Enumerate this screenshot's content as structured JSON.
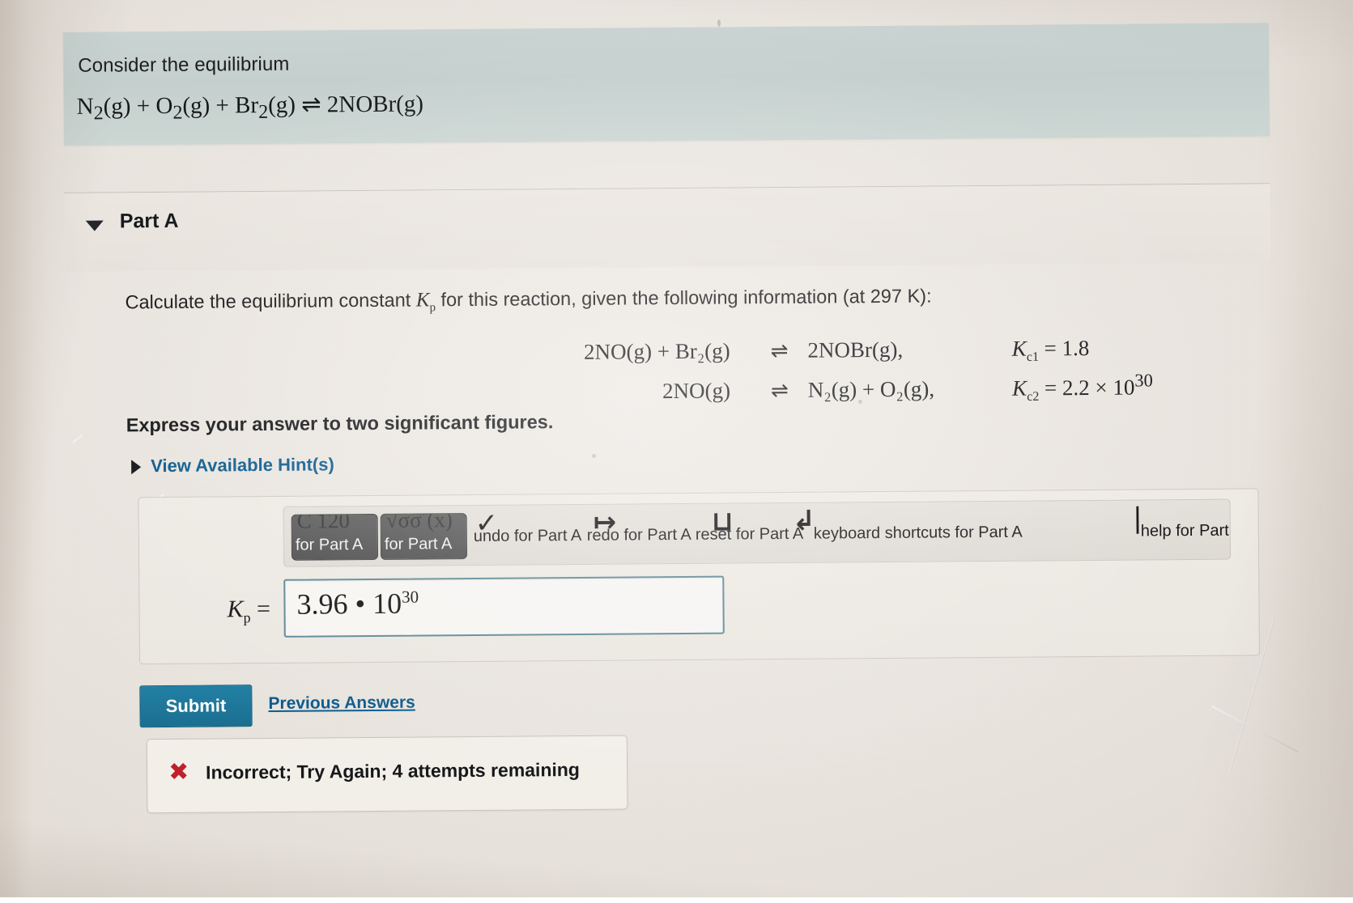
{
  "statement": {
    "intro": "Consider the equilibrium",
    "equation_plain": "N2(g) + O2(g) + Br2(g) ⇌ 2NOBr(g)",
    "equation_parts": {
      "n2": "N",
      "n2_sub": "2",
      "n2_state": "(g)",
      "plus1": "+",
      "o2": "O",
      "o2_sub": "2",
      "o2_state": "(g)",
      "plus2": "+",
      "br2": "Br",
      "br2_sub": "2",
      "br2_state": "(g)",
      "arrow": "⇌",
      "product": "2NOBr(g)"
    }
  },
  "part": {
    "label": "Part A",
    "caret_icon": "triangle-down-icon"
  },
  "question": {
    "text_before_symbol": "Calculate the equilibrium constant ",
    "symbol": "K",
    "symbol_sub": "p",
    "text_after_symbol": " for this reaction, given the following information (at 297 K):",
    "express": "Express your answer to two significant figures.",
    "hints_label": "View Available Hint(s)",
    "hints_caret_icon": "triangle-right-icon"
  },
  "given_equations": {
    "rows": [
      {
        "lhs": "2NO(g) + Br₂(g)",
        "arrow": "⇌",
        "rhs": "2NOBr(g),",
        "k_symbol": "K",
        "k_sub": "c1",
        "k_eq": "=",
        "k_value": "1.8",
        "k_exponent": ""
      },
      {
        "lhs": "2NO(g)",
        "arrow": "⇌",
        "rhs": "N₂(g) + O₂(g),",
        "k_symbol": "K",
        "k_sub": "c2",
        "k_eq": "=",
        "k_value": "2.2 × 10",
        "k_exponent": "30"
      }
    ]
  },
  "toolbar": {
    "buttons": [
      {
        "ghost": "C  120",
        "caption": "for Part A"
      },
      {
        "ghost": "√σσ (x)",
        "caption": "for Part A"
      }
    ],
    "items": [
      {
        "glyph": "✓",
        "label": "undo for Part A",
        "name": "undo-button"
      },
      {
        "glyph": "↦",
        "label": "redo for Part A",
        "name": "redo-button"
      },
      {
        "glyph": "⊔",
        "label": "reset for Part A",
        "name": "reset-button"
      },
      {
        "glyph": "↲",
        "label": "keyboard shortcuts for Part A",
        "name": "keyboard-shortcuts-button"
      },
      {
        "glyph": "❘",
        "label": "help for Part A",
        "name": "help-button"
      }
    ]
  },
  "answer": {
    "label_symbol": "K",
    "label_sub": "p",
    "label_eq": "=",
    "value_mantissa": "3.96 • 10",
    "value_exponent": "30",
    "value_plain": "3.96 • 10^30",
    "placeholder": ""
  },
  "actions": {
    "submit": "Submit",
    "previous_answers": "Previous Answers"
  },
  "feedback": {
    "icon": "red-x-icon",
    "icon_glyph": "✖",
    "message": "Incorrect; Try Again; 4 attempts remaining",
    "icon_color": "#c0202c"
  },
  "colors": {
    "banner": "#c8d3d1",
    "accent_link": "#0c5b8d",
    "submit_bg": "#1f7c9f",
    "input_border": "#5d8897",
    "error": "#c0202c",
    "page_bg": "#eae5df"
  }
}
